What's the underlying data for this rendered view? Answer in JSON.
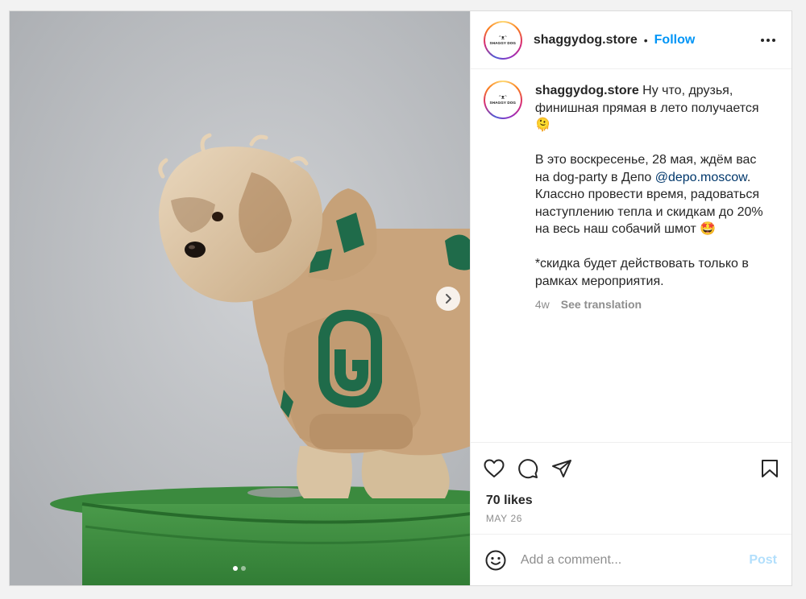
{
  "account": {
    "username": "shaggydog.store",
    "follow_label": "Follow",
    "separator": "•",
    "logo_text": "SHAGGY DOG"
  },
  "caption": {
    "username": "shaggydog.store",
    "line1": " Ну что, друзья, финишная прямая в лето получается 🫠",
    "line2_before": "В это воскресенье, 28 мая, ждём вас на dog-party в Депо ",
    "mention": "@depo.moscow",
    "line2_after": ". Классно провести время, радоваться наступлению тепла и скидкам до 20% на весь наш собачий шмот 🤩",
    "line3": "*скидка будет действовать только в рамках мероприятия.",
    "age": "4w",
    "translate_label": "See translation"
  },
  "stats": {
    "likes": "70 likes",
    "date": "MAY 26"
  },
  "comment_box": {
    "placeholder": "Add a comment...",
    "post_label": "Post"
  },
  "carousel": {
    "current": 1,
    "total": 2
  },
  "icons": [
    "chevron-right-icon",
    "more-icon",
    "heart-icon",
    "comment-icon",
    "share-icon",
    "bookmark-icon",
    "emoji-icon"
  ],
  "colors": {
    "accent": "#0095f6",
    "post_disabled": "#b2dffc",
    "mention": "#00376b",
    "hoodie": "#c9a47c",
    "hoodie_print": "#1f6b4a",
    "barrel": "#3d8a3d"
  }
}
